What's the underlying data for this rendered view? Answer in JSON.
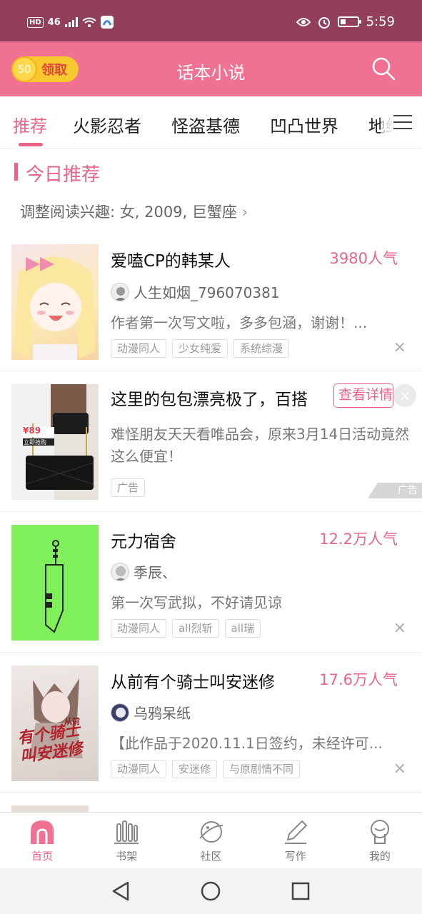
{
  "status_bar": {
    "hd": "HD",
    "network": "46",
    "time": "5:59",
    "battery_level": 0.3
  },
  "header": {
    "coin_amount": "50",
    "claim_label": "领取",
    "title": "话本小说"
  },
  "tabs": [
    "推荐",
    "火影忍者",
    "怪盗基德",
    "凹凸世界",
    "地缚"
  ],
  "section": {
    "title": "今日推荐",
    "interest": "调整阅读兴趣: 女, 2009, 巨蟹座"
  },
  "books": [
    {
      "title": "爱嗑CP的韩某人",
      "popularity": "3980人气",
      "author": "人生如烟_796070381",
      "description": "作者第一次写文啦，多多包涵，谢谢！...",
      "tags": [
        "动漫同人",
        "少女纯爱",
        "系统综漫"
      ]
    },
    {
      "title": "元力宿舍",
      "popularity": "12.2万人气",
      "author": "季辰、",
      "description": "第一次写武拟，不好请见谅",
      "tags": [
        "动漫同人",
        "all烈斩",
        "all瑞"
      ]
    },
    {
      "title": "从前有个骑士叫安迷修",
      "popularity": "17.6万人气",
      "author": "乌鸦呆纸",
      "description": "【此作品于2020.11.1日签约，未经许可...",
      "tags": [
        "动漫同人",
        "安迷修",
        "与原剧情不同"
      ],
      "cover_text": "有个骑士叫安迷修",
      "cover_small": "从前"
    }
  ],
  "ad": {
    "title": "这里的包包漂亮极了，百搭",
    "detail_label": "查看详情",
    "description": "难怪朋友天天看唯品会，原来3月14日活动竟然这么便宜！",
    "tag": "广告",
    "mark": "广告",
    "price": "¥89",
    "buy_label": "立即抢购"
  },
  "close_symbol": "×",
  "bottom_nav": [
    "首页",
    "书架",
    "社区",
    "写作",
    "我的"
  ],
  "colors": {
    "status_bar": "#913f5a",
    "header": "#f07192",
    "accent": "#e86588",
    "coin": "#f7c92d"
  }
}
